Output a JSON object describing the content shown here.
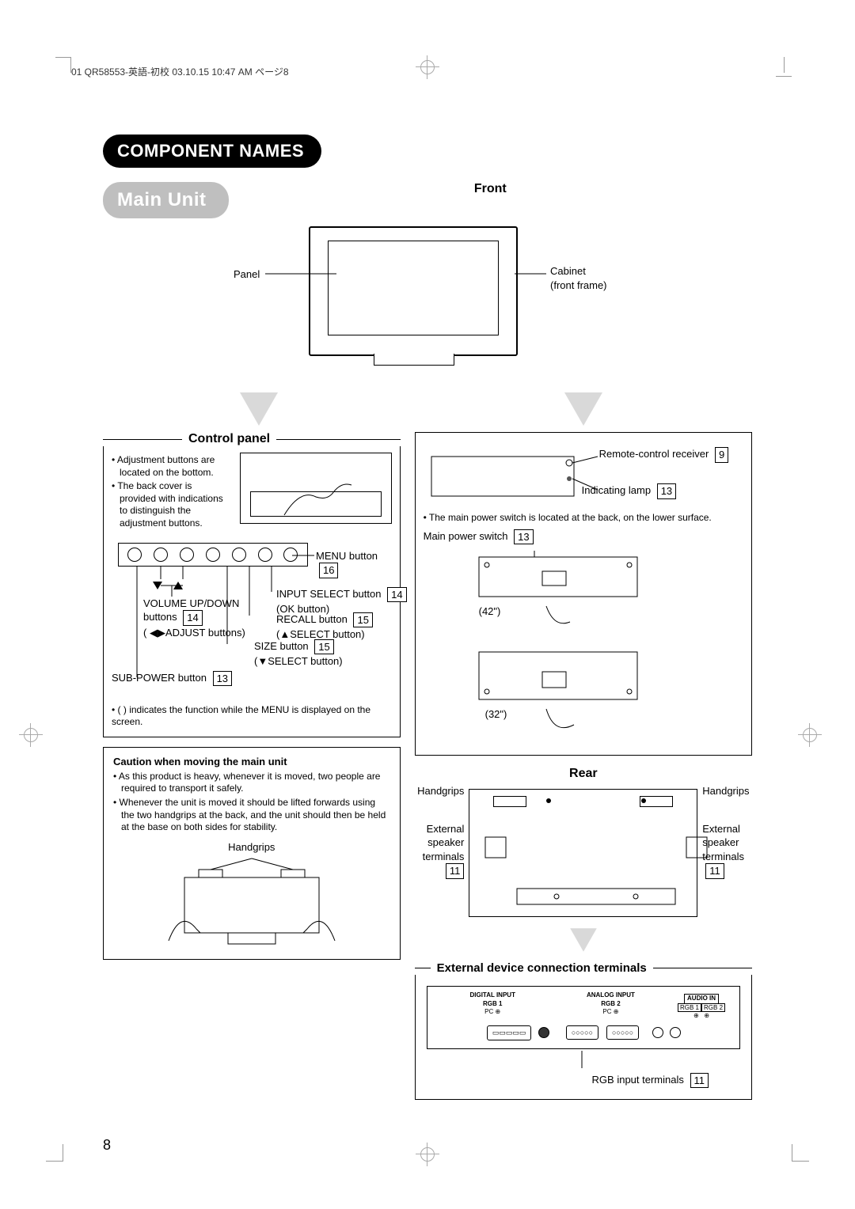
{
  "header_info": "01 QR58553-英語-初校  03.10.15  10:47 AM  ページ8",
  "title_bar": "COMPONENT NAMES",
  "subtitle_bar": "Main Unit",
  "page_number": "8",
  "front": {
    "heading": "Front",
    "label_panel": "Panel",
    "label_cabinet": "Cabinet",
    "label_cabinet2": "(front frame)"
  },
  "control_panel": {
    "heading": "Control panel",
    "notes": [
      "Adjustment buttons are located on the bottom.",
      "The back cover is provided with indications to distinguish the adjustment buttons."
    ],
    "labels": {
      "menu": "MENU button",
      "input_select": "INPUT SELECT button",
      "input_select_sub": "(OK button)",
      "recall": "RECALL button",
      "recall_sub": "(▲SELECT button)",
      "size": "SIZE button",
      "size_sub": "(▼SELECT button)",
      "vol": "VOLUME UP/DOWN buttons",
      "vol_sub": "( ◀▶ADJUST buttons)",
      "sub_power": "SUB-POWER button"
    },
    "refs": {
      "menu": "16",
      "input_select": "14",
      "recall": "15",
      "size": "15",
      "vol": "14",
      "sub_power": "13"
    },
    "footnote": "• (   ) indicates the function while the MENU is displayed on the screen."
  },
  "right_panel": {
    "remote": "Remote-control receiver",
    "remote_ref": "9",
    "indicating": "Indicating lamp",
    "indicating_ref": "13",
    "note": "• The main power switch is located at the back, on the lower surface.",
    "main_power": "Main power switch",
    "main_power_ref": "13",
    "size42": "(42\")",
    "size32": "(32\")"
  },
  "caution": {
    "title": "Caution when moving the main unit",
    "lines": [
      "As this product is heavy, whenever it is moved, two people are required to transport it safely.",
      "Whenever the unit is moved it should be lifted forwards using the two handgrips at the back, and the unit should then be held at the base on both sides for stability."
    ],
    "handgrips_label": "Handgrips"
  },
  "rear": {
    "heading": "Rear",
    "handgrips": "Handgrips",
    "ext_speaker": "External speaker terminals",
    "ext_speaker_ref": "11"
  },
  "ext_terminals": {
    "heading": "External device connection terminals",
    "labels": {
      "digital": "DIGITAL INPUT",
      "rgb1": "RGB 1",
      "pc": "PC",
      "analog": "ANALOG INPUT",
      "rgb2": "RGB 2",
      "audio": "AUDIO IN",
      "audio_sub": "RGB 1 / RGB 2"
    },
    "rgb_input": "RGB input terminals",
    "rgb_input_ref": "11"
  }
}
